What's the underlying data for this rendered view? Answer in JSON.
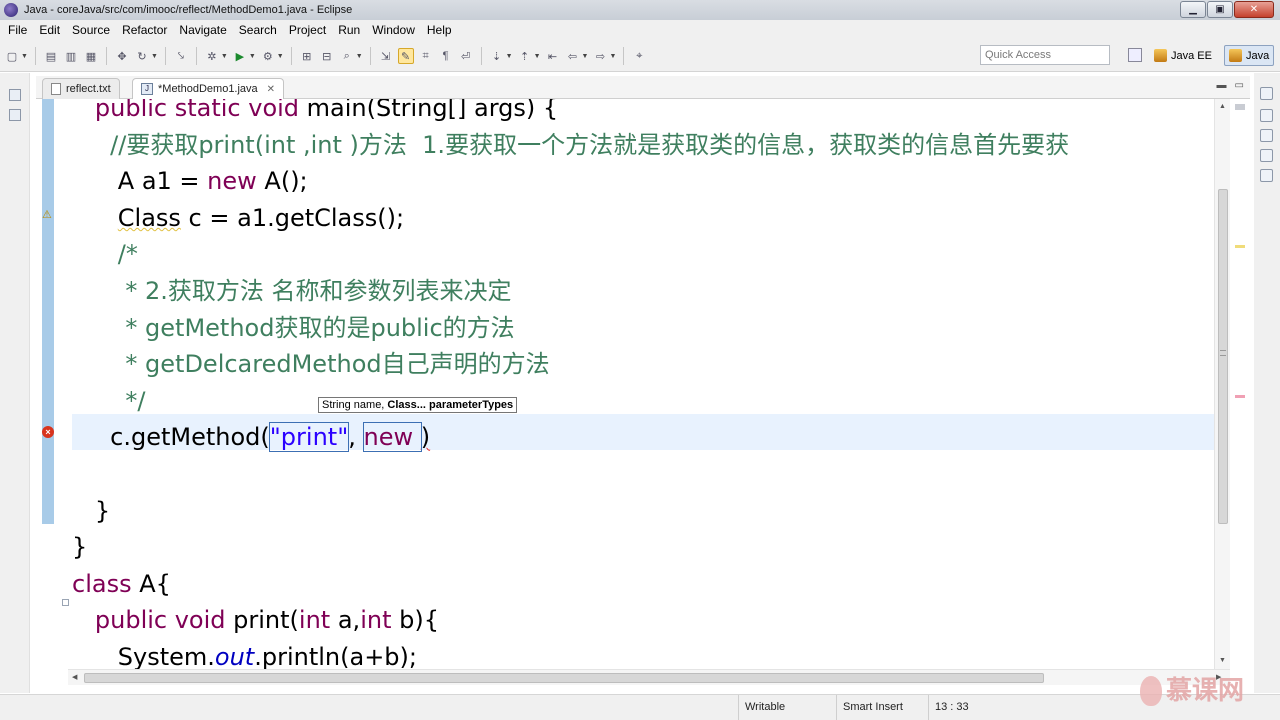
{
  "window": {
    "title": "Java - coreJava/src/com/imooc/reflect/MethodDemo1.java - Eclipse",
    "minimize": "▁",
    "maximize": "▣",
    "close": "✕"
  },
  "menu": [
    "File",
    "Edit",
    "Source",
    "Refactor",
    "Navigate",
    "Search",
    "Project",
    "Run",
    "Window",
    "Help"
  ],
  "toolbar": {
    "quick_access_placeholder": "Quick Access",
    "perspectives": [
      {
        "label": "Java EE"
      },
      {
        "label": "Java",
        "active": true
      }
    ]
  },
  "tabs": [
    {
      "label": "reflect.txt",
      "active": false
    },
    {
      "label": "*MethodDemo1.java",
      "active": true,
      "close": "✕"
    }
  ],
  "editor": {
    "lines": [
      {
        "indent": "   ",
        "parts": [
          {
            "t": "public static void ",
            "c": "kw"
          },
          {
            "t": "main(String[] args) {"
          }
        ]
      },
      {
        "indent": "     ",
        "parts": [
          {
            "t": "//要获取print(int ,int )方法  1.要获取一个方法就是获取类的信息，获取类的信息首先要获",
            "c": "cm"
          }
        ]
      },
      {
        "indent": "      ",
        "parts": [
          {
            "t": "A a1 = "
          },
          {
            "t": "new",
            "c": "kw"
          },
          {
            "t": " A();"
          }
        ]
      },
      {
        "indent": "      ",
        "parts": [
          {
            "t": "Class",
            "c": "warn-ul"
          },
          {
            "t": " c = a1.getClass();"
          }
        ]
      },
      {
        "indent": "      ",
        "parts": [
          {
            "t": "/*",
            "c": "cm"
          }
        ]
      },
      {
        "indent": "       ",
        "parts": [
          {
            "t": "* 2.获取方法 名称和参数列表来决定",
            "c": "cm"
          }
        ]
      },
      {
        "indent": "       ",
        "parts": [
          {
            "t": "* getMethod获取的是public的方法",
            "c": "cm"
          }
        ]
      },
      {
        "indent": "       ",
        "parts": [
          {
            "t": "* getDelcaredMethod自己声明的方法",
            "c": "cm"
          }
        ]
      },
      {
        "indent": "       ",
        "parts": [
          {
            "t": "*/",
            "c": "cm"
          }
        ]
      },
      {
        "indent": "     ",
        "parts": [
          {
            "t": "c.getMethod("
          },
          {
            "t": "\"print\"",
            "c": "st lk"
          },
          {
            "t": ", "
          },
          {
            "t": "new ",
            "c": "kw lk"
          },
          {
            "t": ")",
            "c": "err-ul"
          }
        ]
      },
      {
        "indent": "",
        "parts": [
          {
            "t": ""
          }
        ]
      },
      {
        "indent": "   ",
        "parts": [
          {
            "t": "}"
          }
        ]
      },
      {
        "indent": "",
        "parts": [
          {
            "t": "}"
          }
        ]
      },
      {
        "indent": "",
        "parts": [
          {
            "t": "class",
            "c": "kw"
          },
          {
            "t": " A{"
          }
        ]
      },
      {
        "indent": "   ",
        "parts": [
          {
            "t": "public void ",
            "c": "kw"
          },
          {
            "t": "print("
          },
          {
            "t": "int",
            "c": "kw"
          },
          {
            "t": " a,"
          },
          {
            "t": "int",
            "c": "kw"
          },
          {
            "t": " b){"
          }
        ]
      },
      {
        "indent": "      ",
        "parts": [
          {
            "t": "System."
          },
          {
            "t": "out",
            "c": "fld"
          },
          {
            "t": ".println(a+b);"
          }
        ]
      }
    ],
    "param_hint": {
      "normal": "String name, ",
      "bold": "Class... parameterTypes"
    }
  },
  "status": {
    "writable": "Writable",
    "insert_mode": "Smart Insert",
    "position": "13 : 33"
  },
  "watermark": "慕课网",
  "icons": [
    "eclipse-app-icon",
    "new-icon",
    "save-icon",
    "print-icon",
    "debug-icon",
    "run-icon",
    "search-icon",
    "back-icon",
    "forward-icon"
  ]
}
